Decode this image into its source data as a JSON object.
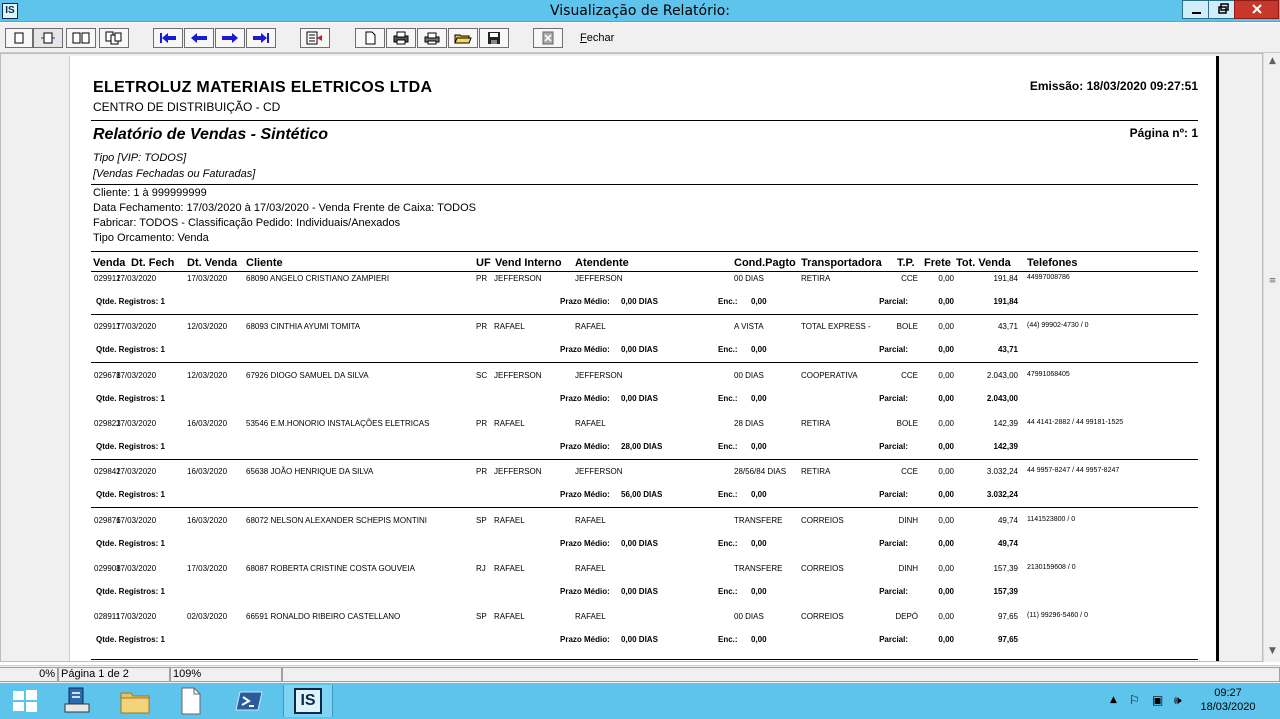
{
  "window": {
    "title": "Visualização de Relatório:",
    "icon_text": "IS"
  },
  "toolbar": {
    "fechar_label": "Fechar",
    "fechar_mnemonic": "F",
    "fechar_rest": "echar"
  },
  "report": {
    "company": "ELETROLUZ MATERIAIS ELETRICOS LTDA",
    "subtitle": "CENTRO DE DISTRIBUIÇÃO - CD",
    "emissao": "Emissão: 18/03/2020 09:27:51",
    "title": "Relatório de Vendas - Sintético",
    "pagina": "Página nº: 1",
    "tipo": "Tipo [VIP: TODOS]",
    "vendas_tipo": "[Vendas Fechadas ou Faturadas]",
    "filters": [
      "Cliente: 1 à 999999999",
      "Data Fechamento: 17/03/2020 à 17/03/2020 - Venda Frente de Caixa: TODOS",
      "Fabricar: TODOS - Classificação Pedido: Individuais/Anexados",
      "Tipo Orcamento: Venda"
    ],
    "columns": [
      "Venda",
      "Dt. Fech",
      "Dt. Venda",
      "Cliente",
      "UF",
      "Vend Interno",
      "Atendente",
      "Cond.Pagto",
      "Transportadora",
      "T.P.",
      "Frete",
      "Tot. Venda",
      "Telefones"
    ],
    "qtde_label": "Qtde. Registros: 1",
    "prazo_label": "Prazo Médio:",
    "enc_label": "Enc.:",
    "parcial_label": "Parcial:",
    "rows": [
      {
        "venda": "029912",
        "dt_fech": "17/03/2020",
        "dt_venda": "17/03/2020",
        "cliente": "68090 ANGELO CRISTIANO ZAMPIERI",
        "uf": "PR",
        "vend": "JEFFERSON",
        "atendente": "JEFFERSON",
        "cond": "00 DIAS",
        "transp": "RETIRA",
        "tp": "CCE",
        "frete": "0,00",
        "tot": "191,84",
        "tel": "44997008786",
        "prazo": "0,00 DIAS",
        "enc": "0,00",
        "parc_frete": "0,00",
        "parc_tot": "191,84"
      },
      {
        "venda": "029917",
        "dt_fech": "17/03/2020",
        "dt_venda": "12/03/2020",
        "cliente": "68093 CINTHIA AYUMI TOMITA",
        "uf": "PR",
        "vend": "RAFAEL",
        "atendente": "RAFAEL",
        "cond": "A VISTA",
        "transp": "TOTAL EXPRESS -",
        "tp": "BOLE",
        "frete": "0,00",
        "tot": "43,71",
        "tel": "(44) 99902-4730 / 0",
        "prazo": "0,00 DIAS",
        "enc": "0,00",
        "parc_frete": "0,00",
        "parc_tot": "43,71"
      },
      {
        "venda": "029678",
        "dt_fech": "17/03/2020",
        "dt_venda": "12/03/2020",
        "cliente": "67926 DIOGO SAMUEL DA SILVA",
        "uf": "SC",
        "vend": "JEFFERSON",
        "atendente": "JEFFERSON",
        "cond": "00 DIAS",
        "transp": "COOPERATIVA",
        "tp": "CCE",
        "frete": "0,00",
        "tot": "2.043,00",
        "tel": "47991068405",
        "prazo": "0,00 DIAS",
        "enc": "0,00",
        "parc_frete": "0,00",
        "parc_tot": "2.043,00"
      },
      {
        "venda": "029823",
        "dt_fech": "17/03/2020",
        "dt_venda": "16/03/2020",
        "cliente": "53546 E.M.HONORIO INSTALAÇÕES ELETRICAS",
        "uf": "PR",
        "vend": "RAFAEL",
        "atendente": "RAFAEL",
        "cond": "28 DIAS",
        "transp": "RETIRA",
        "tp": "BOLE",
        "frete": "0,00",
        "tot": "142,39",
        "tel": "44 4141-2882 / 44 99181-1525",
        "prazo": "28,00 DIAS",
        "enc": "0,00",
        "parc_frete": "0,00",
        "parc_tot": "142,39"
      },
      {
        "venda": "029842",
        "dt_fech": "17/03/2020",
        "dt_venda": "16/03/2020",
        "cliente": "65638 JOÃO HENRIQUE DA SILVA",
        "uf": "PR",
        "vend": "JEFFERSON",
        "atendente": "JEFFERSON",
        "cond": "28/56/84 DIAS",
        "transp": "RETIRA",
        "tp": "CCE",
        "frete": "0,00",
        "tot": "3.032,24",
        "tel": "44 9957-8247 / 44 9957-8247",
        "prazo": "56,00 DIAS",
        "enc": "0,00",
        "parc_frete": "0,00",
        "parc_tot": "3.032,24"
      },
      {
        "venda": "029876",
        "dt_fech": "17/03/2020",
        "dt_venda": "16/03/2020",
        "cliente": "68072 NELSON ALEXANDER SCHEPIS MONTINI",
        "uf": "SP",
        "vend": "RAFAEL",
        "atendente": "RAFAEL",
        "cond": "TRANSFERE",
        "transp": "CORREIOS",
        "tp": "DINH",
        "frete": "0,00",
        "tot": "49,74",
        "tel": "1141523800 / 0",
        "prazo": "0,00 DIAS",
        "enc": "0,00",
        "parc_frete": "0,00",
        "parc_tot": "49,74"
      },
      {
        "venda": "029908",
        "dt_fech": "17/03/2020",
        "dt_venda": "17/03/2020",
        "cliente": "68087 ROBERTA CRISTINE COSTA GOUVEIA",
        "uf": "RJ",
        "vend": "RAFAEL",
        "atendente": "RAFAEL",
        "cond": "TRANSFERE",
        "transp": "CORREIOS",
        "tp": "DINH",
        "frete": "0,00",
        "tot": "157,39",
        "tel": "2130159608 / 0",
        "prazo": "0,00 DIAS",
        "enc": "0,00",
        "parc_frete": "0,00",
        "parc_tot": "157,39"
      },
      {
        "venda": "028911",
        "dt_fech": "17/03/2020",
        "dt_venda": "02/03/2020",
        "cliente": "66591 RONALDO RIBEIRO CASTELLANO",
        "uf": "SP",
        "vend": "RAFAEL",
        "atendente": "RAFAEL",
        "cond": "00 DIAS",
        "transp": "CORREIOS",
        "tp": "DEPÓ",
        "frete": "0,00",
        "tot": "97,65",
        "tel": "(11) 99296-5460 / 0",
        "prazo": "0,00 DIAS",
        "enc": "0,00",
        "parc_frete": "0,00",
        "parc_tot": "97,65"
      }
    ]
  },
  "statusbar": {
    "progress": "0%",
    "page": "Página 1 de 2",
    "zoom": "109%"
  },
  "taskbar": {
    "active_app": "IS",
    "time": "09:27",
    "date": "18/03/2020"
  }
}
